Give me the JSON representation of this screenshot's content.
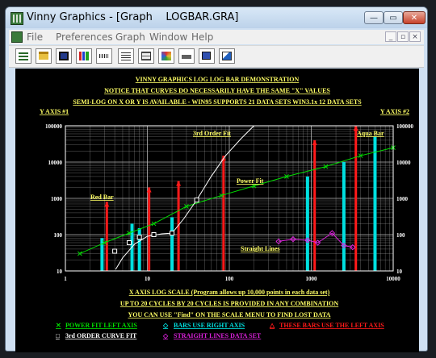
{
  "window": {
    "title": "Vinny Graphics - [Graph    LOGBAR.GRA]",
    "min_icon": "minimize-icon",
    "max_icon": "maximize-icon",
    "close_icon": "close-icon",
    "min_glyph": "—",
    "max_glyph": "▭",
    "close_glyph": "✕"
  },
  "menu": {
    "items": [
      "File",
      "Preferences",
      "Graph",
      "Window",
      "Help"
    ],
    "mdi_min": "_",
    "mdi_restore": "▫",
    "mdi_close": "×"
  },
  "toolbar": {
    "icons": [
      "spreadsheet-icon",
      "open-folder-icon",
      "save-icon",
      "bar-chart-icon",
      "ruler-icon",
      "grid-icon",
      "table-icon",
      "palette-icon",
      "print-icon",
      "copy-icon",
      "windows-icon"
    ]
  },
  "colors": {
    "background": "#000000",
    "grid": "#c8c8c8",
    "header": "#ffff66",
    "power_fit": "#00dd00",
    "bars_right": "#00e0e0",
    "bars_left": "#ff1a1a",
    "curve_fit": "#ffffff",
    "straight_lines": "#dd22dd"
  },
  "chart_data": {
    "type": "bar",
    "title_lines": [
      "VINNY GRAPHICS LOG LOG BAR DEMONSTRATION",
      "NOTICE THAT CURVES DO NECESSARILY HAVE THE SAME \"X\" VALUES",
      "SEMI-LOG ON X OR Y IS AVAILABLE - WIN95 SUPPORTS 21 DATA SETS WIN3.1x 12 DATA SETS"
    ],
    "y_left_title": "Y AXIS #1",
    "y_right_title": "Y AXIS #2",
    "x_title_lines": [
      "X AXIS LOG SCALE (Program allows up 10,000 points in each data set)",
      "UP TO 20 CYCLES BY 20 CYCLES IS PROVIDED IN ANY COMBINATION",
      "YOU CAN USE \"Find\" ON THE SCALE MENU TO FIND LOST DATA"
    ],
    "x_scale": "log",
    "y_scale": "log",
    "xlim": [
      1,
      10000
    ],
    "ylim_left": [
      10,
      100000
    ],
    "ylim_right": [
      10,
      100000
    ],
    "x_ticks": [
      "1",
      "10",
      "100",
      "1000",
      "10000"
    ],
    "y_left_ticks": [
      "10",
      "100",
      "1000",
      "10000",
      "100000"
    ],
    "y_right_ticks": [
      "10",
      "100",
      "1000",
      "10000",
      "100000"
    ],
    "grid": true,
    "annotations": [
      "Red Bar",
      "3rd Order Fit",
      "Power Fit",
      "Straight Lines",
      "Aqua Bar"
    ],
    "series": [
      {
        "name": "POWER FIT LEFT AXIS",
        "kind": "line+markers",
        "axis": "left",
        "marker": "x",
        "x": [
          1.5,
          3,
          6,
          12,
          30,
          80,
          200,
          500,
          1500,
          4000,
          10000
        ],
        "y": [
          30,
          60,
          110,
          200,
          600,
          1200,
          2200,
          4000,
          7500,
          15000,
          25000
        ]
      },
      {
        "name": "BARS USE RIGHT AXIS",
        "kind": "bar",
        "axis": "right",
        "x": [
          2.8,
          6.5,
          8,
          20,
          900,
          2500,
          6000
        ],
        "y": [
          80,
          200,
          150,
          300,
          4000,
          10000,
          50000
        ]
      },
      {
        "name": "THESE BARS USE THE LEFT AXIS",
        "kind": "bar",
        "axis": "left",
        "x": [
          3.2,
          10.5,
          24,
          85,
          1100,
          3500
        ],
        "y": [
          800,
          2000,
          3000,
          15000,
          40000,
          100000
        ]
      },
      {
        "name": "3rd ORDER CURVE FIT",
        "kind": "curve+markers",
        "axis": "left",
        "marker": "square",
        "x": [
          4,
          6,
          8,
          12,
          20,
          40,
          100,
          200
        ],
        "y": [
          35,
          60,
          85,
          100,
          110,
          900,
          60000,
          100000
        ],
        "curve_x": [
          4.1,
          5,
          7,
          10,
          15,
          20,
          28,
          40,
          60,
          90,
          140,
          200
        ],
        "curve_y": [
          11,
          23,
          55,
          90,
          105,
          110,
          280,
          900,
          4000,
          15000,
          45000,
          100000
        ]
      },
      {
        "name": "STRAIGHT LINES DATA SET",
        "kind": "line+markers",
        "axis": "left",
        "marker": "diamond",
        "x": [
          400,
          600,
          900,
          1200,
          1800,
          2500,
          3200
        ],
        "y": [
          65,
          75,
          70,
          60,
          110,
          50,
          45
        ]
      }
    ],
    "legend": [
      {
        "marker": "✕",
        "label": "POWER  FIT LEFT AXIS",
        "color": "#00dd00"
      },
      {
        "marker": "◇",
        "label": "BARS USE RIGHT AXIS",
        "color": "#00e0e0"
      },
      {
        "marker": "△",
        "label": "THESE BARS USE THE LEFT AXIS",
        "color": "#ff1a1a"
      },
      {
        "marker": "□",
        "label": "3rd ORDER CURVE FIT",
        "color": "#ffffff"
      },
      {
        "marker": "◇",
        "label": "STRAIGHT LINES DATA SET",
        "color": "#dd22dd"
      }
    ]
  }
}
